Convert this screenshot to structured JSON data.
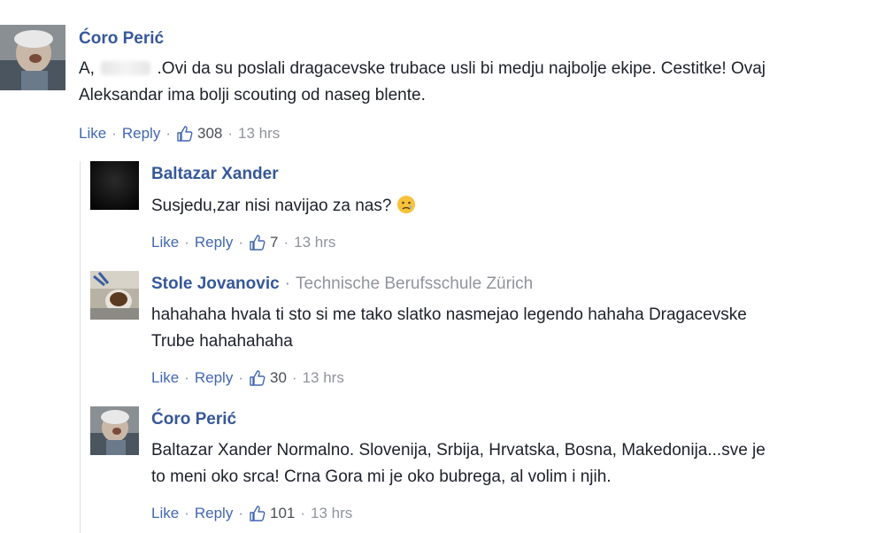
{
  "colors": {
    "link": "#4267b2",
    "author": "#365899",
    "meta": "#90949c",
    "text": "#1d2129",
    "thread_line": "#dddfe2"
  },
  "action_labels": {
    "like": "Like",
    "reply": "Reply"
  },
  "comments": [
    {
      "author": "Ćoro Perić",
      "text_line1_pre": "A, ",
      "text_line1_post": " .Ovi da su poslali dragacevske trubace usli bi medju najbolje ekipe. Cestitke! Ovaj",
      "text_line2": "Aleksandar ima bolji scouting od naseg blente.",
      "likes": "308",
      "time": "13 hrs"
    },
    {
      "author": "Baltazar Xander",
      "text": "Susjedu,zar nisi navijao za nas?",
      "emoji": "worried-face-icon",
      "likes": "7",
      "time": "13 hrs"
    },
    {
      "author": "Stole Jovanovic",
      "affiliation": "Technische Berufsschule Zürich",
      "text_line1": "hahahaha hvala ti sto si me tako slatko nasmejao legendo hahaha Dragacevske",
      "text_line2": "Trube hahahahaha",
      "likes": "30",
      "time": "13 hrs"
    },
    {
      "author": "Ćoro Perić",
      "text_line1": "Baltazar Xander Normalno. Slovenija, Srbija, Hrvatska, Bosna, Makedonija...sve je",
      "text_line2": "to meni oko srca! Crna Gora mi je oko bubrega, al volim i njih.",
      "likes": "101",
      "time": "13 hrs"
    }
  ]
}
